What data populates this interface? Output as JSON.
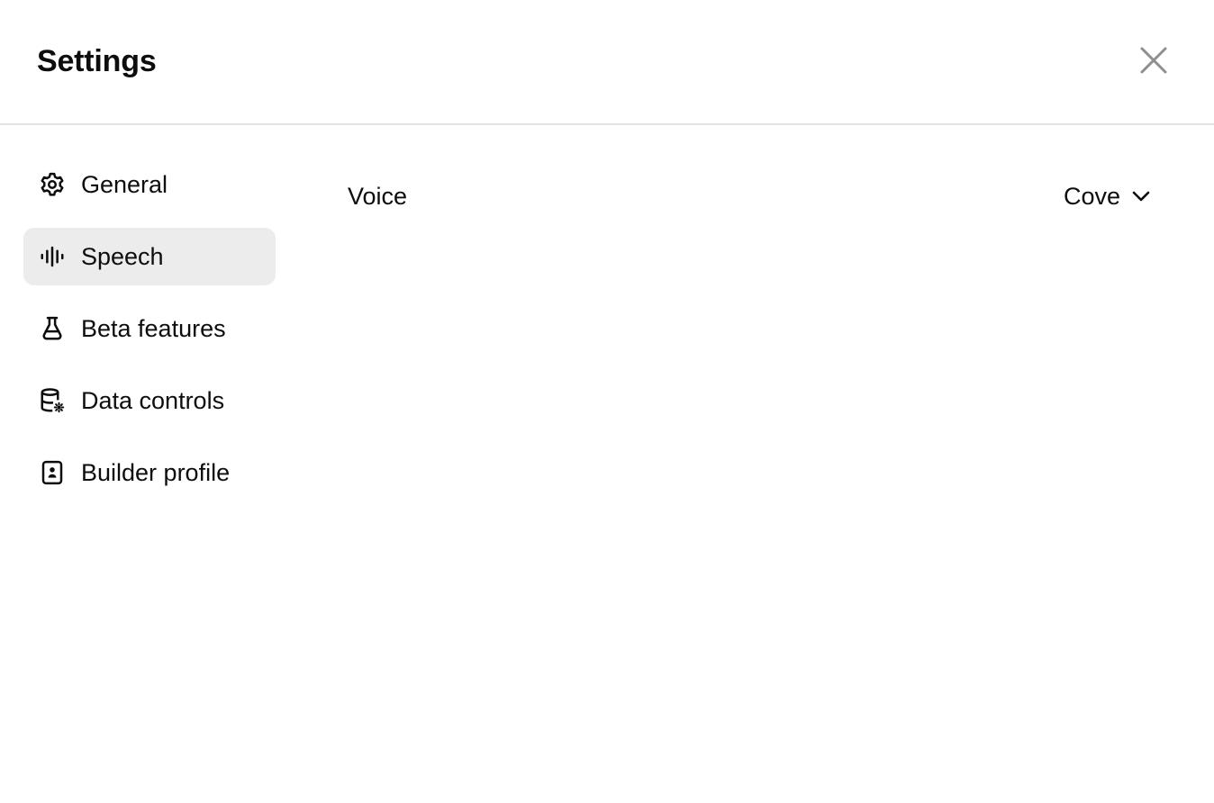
{
  "dialog": {
    "title": "Settings",
    "close_icon": "close-icon"
  },
  "sidebar": {
    "active_index": 1,
    "items": [
      {
        "label": "General",
        "icon": "gear-icon"
      },
      {
        "label": "Speech",
        "icon": "audio-waveform-icon"
      },
      {
        "label": "Beta features",
        "icon": "flask-icon"
      },
      {
        "label": "Data controls",
        "icon": "database-settings-icon"
      },
      {
        "label": "Builder profile",
        "icon": "id-badge-icon"
      }
    ]
  },
  "speech": {
    "voice_label": "Voice",
    "voice_value": "Cove",
    "dropdown_icon": "chevron-down-icon"
  },
  "colors": {
    "active_background": "#ececec",
    "divider": "#e3e3e3",
    "text": "#0d0d0d",
    "close_icon": "#8f8f8f"
  }
}
